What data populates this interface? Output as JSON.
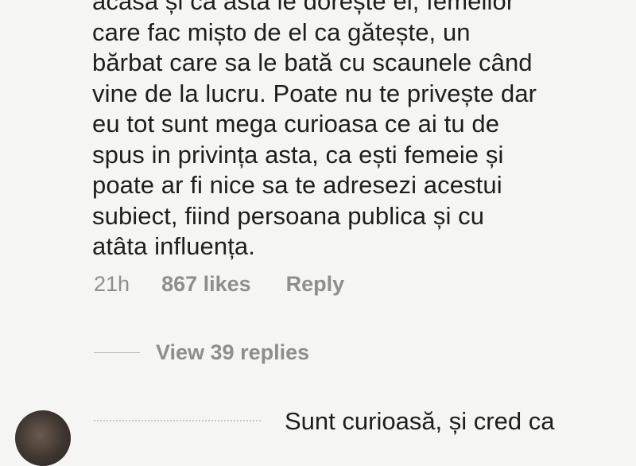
{
  "comment": {
    "lines": [
      "acasă și ca asta le dorește el, femeilor",
      "care fac mișto de el ca gătește, un",
      "bărbat care sa le bată cu scaunele când",
      "vine de la lucru. Poate nu te privește dar",
      "eu tot sunt mega curioasa ce ai tu de",
      "spus in privința asta, ca ești femeie și",
      "poate ar fi nice sa te adresezi acestui",
      "subiect, fiind persoana publica și cu",
      "atâta influența."
    ],
    "time": "21h",
    "likes": "867 likes",
    "reply_label": "Reply",
    "view_replies": "View 39 replies"
  },
  "next_comment": {
    "text_partial": "Sunt curioasă, și cred ca"
  },
  "colors": {
    "background": "#f5f5f4",
    "text": "#1e1e1e",
    "meta": "#8e8e8e"
  }
}
